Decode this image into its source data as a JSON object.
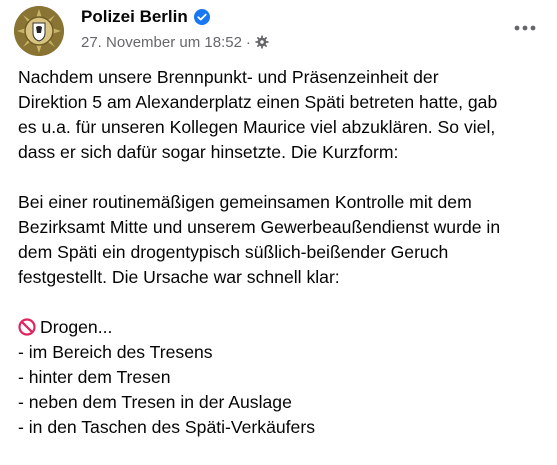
{
  "post": {
    "author": "Polizei Berlin",
    "timestamp": "27. November um 18:52",
    "separator": "·",
    "icons": {
      "avatar": "police-badge-icon",
      "verified": "verified-badge-icon",
      "audience": "public-gear-icon",
      "more": "more-dots-icon",
      "prohibited": "no-entry-emoji-icon"
    },
    "paragraph1": [
      "Nachdem unsere Brennpunkt- und Präsenzeinheit der",
      "Direktion 5 am Alexanderplatz einen Späti betreten hatte, gab",
      "es u.a. für unseren Kollegen Maurice viel abzuklären. So viel,",
      "dass er sich dafür sogar hinsetzte. Die Kurzform:"
    ],
    "paragraph2": [
      "Bei einer routinemäßigen gemeinsamen Kontrolle mit dem",
      "Bezirksamt Mitte und unserem Gewerbeaußendienst wurde in",
      "dem Späti ein drogentypisch süßlich-beißender Geruch",
      "festgestellt. Die Ursache war schnell klar:"
    ],
    "list_heading": "Drogen...",
    "list_items": [
      "- im Bereich des Tresens",
      "- hinter dem Tresen",
      "- neben dem Tresen in der Auslage",
      "- in den Taschen des Späti-Verkäufers"
    ],
    "colors": {
      "verified": "#1877f2",
      "meta": "#65676b",
      "avatar_gold": "#8a7433",
      "prohibited_red": "#e0245e"
    }
  }
}
